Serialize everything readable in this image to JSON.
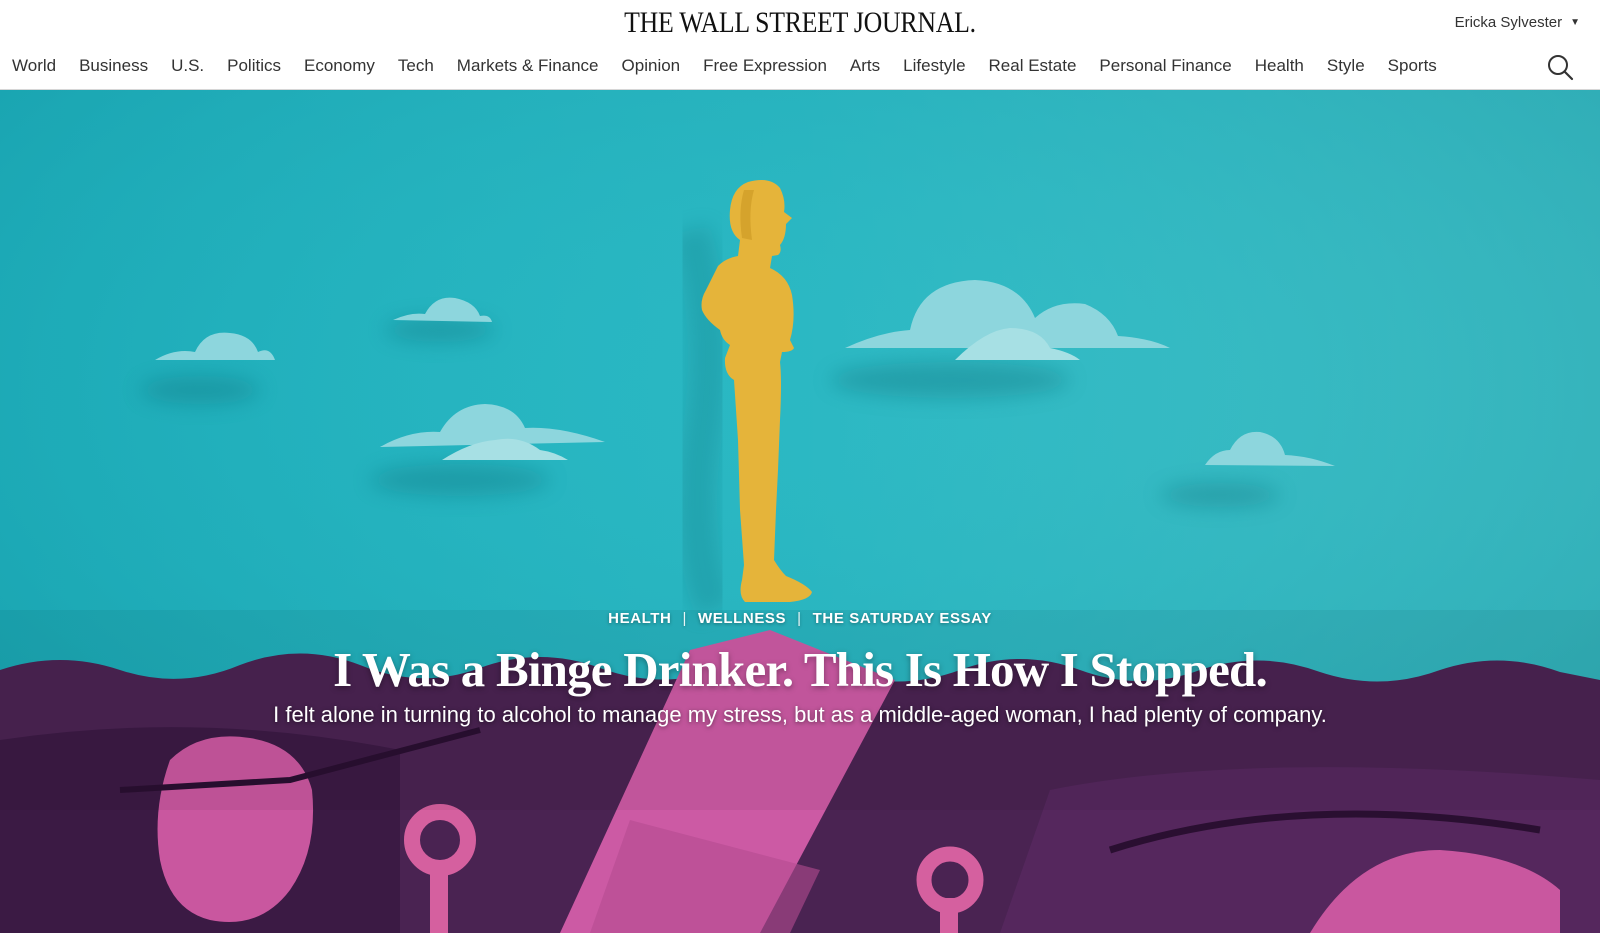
{
  "header": {
    "masthead": "THE WALL STREET JOURNAL.",
    "user_name": "Ericka Sylvester",
    "nav": [
      {
        "label": "World"
      },
      {
        "label": "Business"
      },
      {
        "label": "U.S."
      },
      {
        "label": "Politics"
      },
      {
        "label": "Economy"
      },
      {
        "label": "Tech"
      },
      {
        "label": "Markets & Finance"
      },
      {
        "label": "Opinion"
      },
      {
        "label": "Free Expression"
      },
      {
        "label": "Arts"
      },
      {
        "label": "Lifestyle"
      },
      {
        "label": "Real Estate"
      },
      {
        "label": "Personal Finance"
      },
      {
        "label": "Health"
      },
      {
        "label": "Style"
      },
      {
        "label": "Sports"
      }
    ],
    "icons": {
      "search": "search-icon",
      "user_caret": "caret-down-icon"
    }
  },
  "hero": {
    "kickers": [
      {
        "label": "HEALTH"
      },
      {
        "label": "WELLNESS"
      },
      {
        "label": "THE SATURDAY ESSAY"
      }
    ],
    "headline": "I Was a Binge Drinker. This Is How I Stopped.",
    "dek": "I felt alone in turning to alcohol to manage my stress, but as a middle-aged woman, I had plenty of company.",
    "colors": {
      "sky": "#22b4c0",
      "figure": "#e5b43a",
      "ground": "#4a2352",
      "pink": "#c9579f",
      "cloud": "#7fd0d8"
    }
  }
}
